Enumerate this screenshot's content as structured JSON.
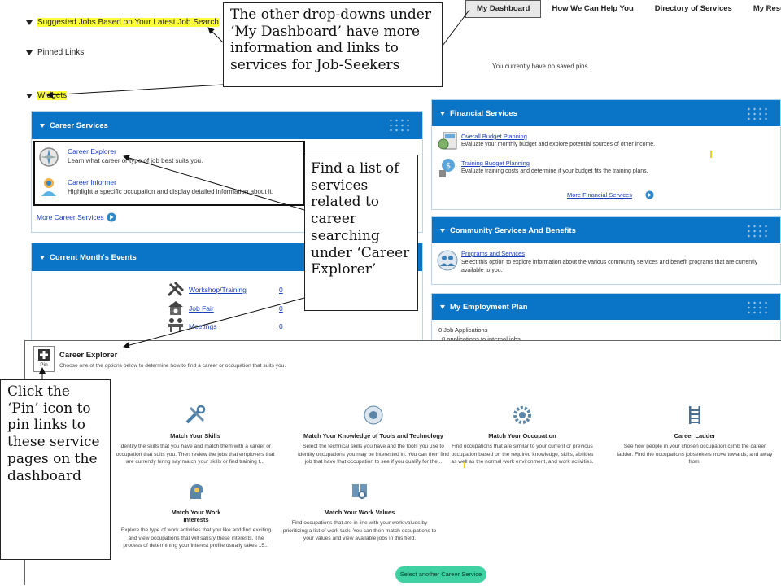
{
  "nav": {
    "items": [
      {
        "label": "My Dashboard",
        "active": true
      },
      {
        "label": "How We Can Help You",
        "active": false
      },
      {
        "label": "Directory of Services",
        "active": false
      },
      {
        "label": "My Resources",
        "active": false
      }
    ]
  },
  "sections": {
    "suggested_jobs": "Suggested Jobs Based on Your Latest Job Search",
    "pinned_links": "Pinned Links",
    "no_pins": "You currently have no saved pins.",
    "widgets": "Widgets"
  },
  "career_services": {
    "title": "Career Services",
    "items": [
      {
        "link": "Career Explorer",
        "desc": "Learn what career or type of job best suits you."
      },
      {
        "link": "Career Informer",
        "desc": "Highlight a specific occupation and display detailed information about it."
      }
    ],
    "more": "More Career Services"
  },
  "events": {
    "title": "Current Month's Events",
    "items": [
      {
        "label": "Workshop/Training",
        "count": "0"
      },
      {
        "label": "Job Fair",
        "count": "0"
      },
      {
        "label": "Meetings",
        "count": "0"
      }
    ]
  },
  "financial": {
    "title": "Financial Services",
    "items": [
      {
        "link": "Overall Budget Planning",
        "desc": "Evaluate your monthly budget and explore potential sources of other income."
      },
      {
        "link": "Training Budget Planning",
        "desc": "Evaluate training costs and determine if your budget fits the training plans."
      }
    ],
    "more": "More Financial Services"
  },
  "community": {
    "title": "Community Services And Benefits",
    "link": "Programs and Services",
    "desc": "Select this option to explore information about the various community services and benefit programs that are currently available to you."
  },
  "employment": {
    "title": "My Employment Plan",
    "line1": "0 Job Applications",
    "line2": "0 applications to internal jobs"
  },
  "career_explorer": {
    "pin_label": "Pin",
    "title": "Career Explorer",
    "subtitle": "Choose one of the options below to determine how to find a career or occupation that suits you.",
    "options": [
      {
        "title": "Match Your Skills",
        "desc": "Identify the skills that you have and match them with a career or occupation that suits you. Then review the jobs that employers that are currently hiring say match your skills or find training t..."
      },
      {
        "title": "Match Your Knowledge of Tools and Technology",
        "desc": "Select the technical skills you have and the tools you use to identify occupations you may be interested in. You can then find job that have that occupation to see if you qualify for the..."
      },
      {
        "title": "Match Your Occupation",
        "desc": "Find occupations that are similar to your current or previous occupation based on the required knowledge, skills, abilities as well as the normal work environment, and work activities."
      },
      {
        "title": "Career Ladder",
        "desc": "See how people in your chosen occupation climb the career ladder. Find the occupations jobseekers move towards, and away from."
      },
      {
        "title": "Match Your Work Interests",
        "desc": "Explore the type of work activities that you like and find exciting and view occupations that will satisfy these interests. The process of determining your interest profile usually takes 15..."
      },
      {
        "title": "Match Your Work Values",
        "desc": "Find occupations that are in line with your work values by prioritizing a list of work task. You can then match occupations to your values and view available jobs in this field."
      }
    ],
    "button": "Select another Career Service"
  },
  "callouts": {
    "top": "The other drop-downs under ‘My Dashboard’ have more information and links to services for Job-Seekers",
    "middle": "Find a list of services related to career searching under ‘Career Explorer’",
    "left": "Click the ‘Pin’ icon to pin links to these service pages on the dashboard"
  },
  "colors": {
    "widget_blue": "#0a74c6",
    "highlight": "#ffff3a",
    "button_green": "#3fd1a2",
    "link": "#1a3fb8"
  }
}
